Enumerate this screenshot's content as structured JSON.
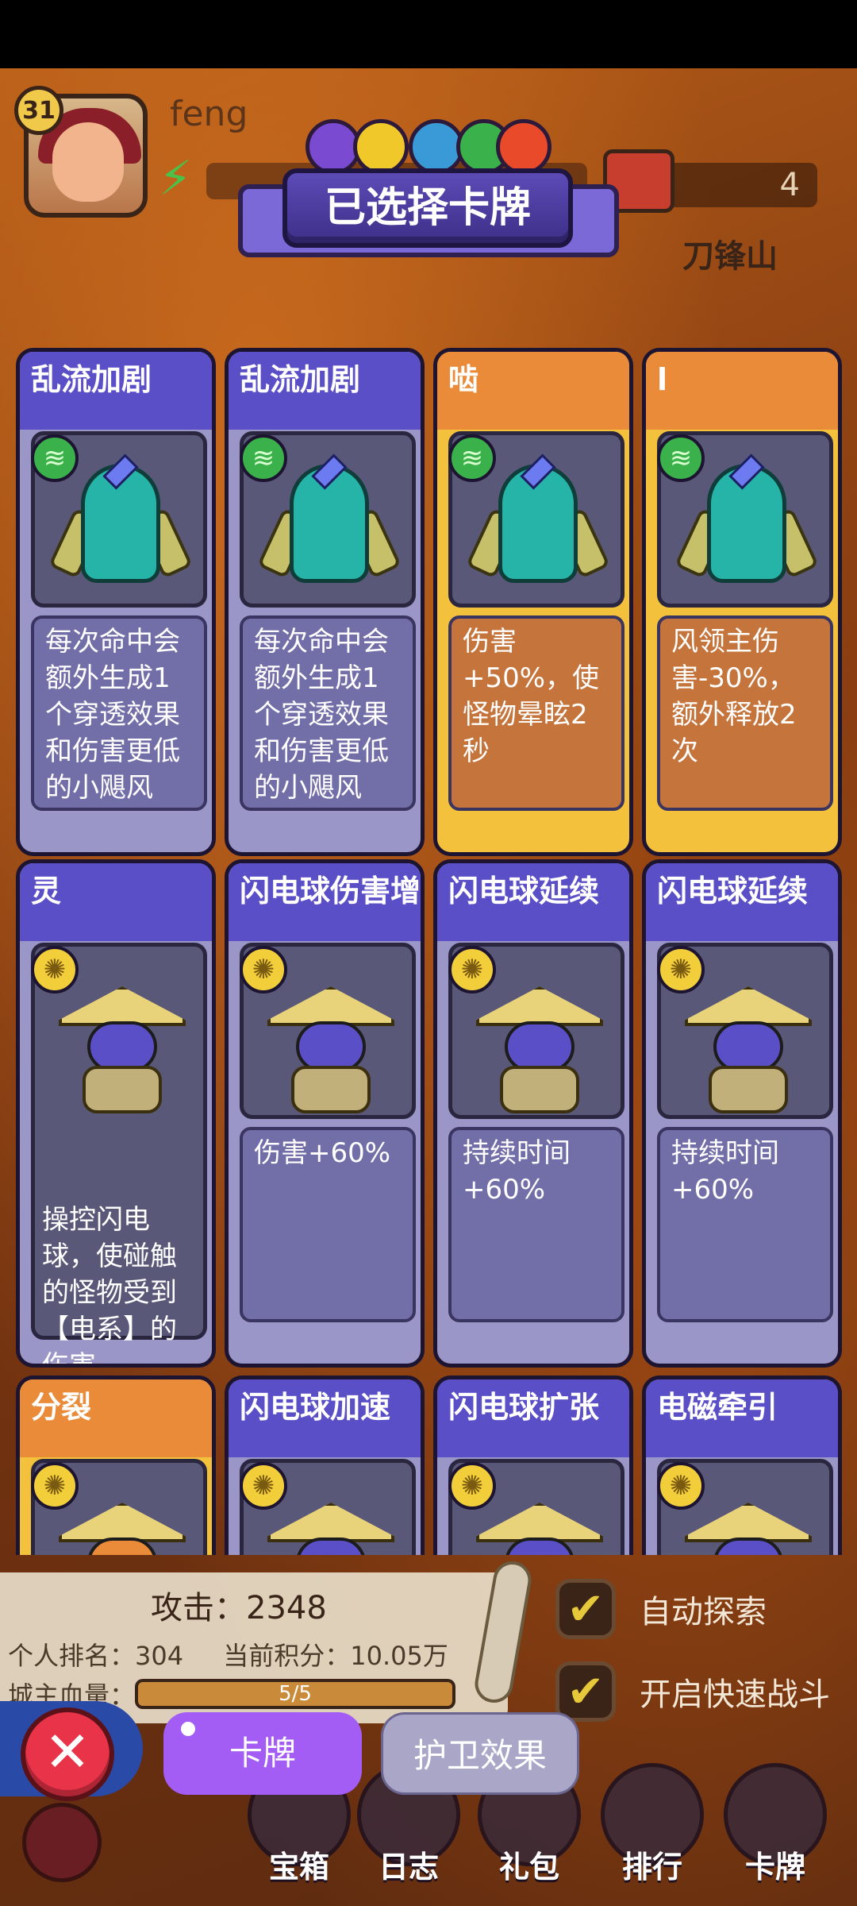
{
  "hud": {
    "level": "31",
    "username": "feng",
    "resource_value": "4",
    "location": "刀锋山"
  },
  "banner": {
    "title": "已选择卡牌"
  },
  "cards": [
    {
      "title": "乱流加剧",
      "color": "purple",
      "type": "wind",
      "desc": "每次命中会额外生成1个穿透效果和伤害更低的小飓风"
    },
    {
      "title": "乱流加剧",
      "color": "purple",
      "type": "wind",
      "desc": "每次命中会额外生成1个穿透效果和伤害更低的小飓风"
    },
    {
      "title": "啮",
      "color": "orange",
      "type": "wind",
      "desc": "伤害+50%，使怪物晕眩2秒"
    },
    {
      "title": "l",
      "color": "orange",
      "type": "wind",
      "desc": "风领主伤害-30%，额外释放2次"
    },
    {
      "title": "灵",
      "color": "purple",
      "type": "elec",
      "desc": "操控闪电球，使碰触的怪物受到【电系】的伤害"
    },
    {
      "title": "闪电球伤害增",
      "color": "purple",
      "type": "elec",
      "desc": "伤害+60%"
    },
    {
      "title": "闪电球延续",
      "color": "purple",
      "type": "elec",
      "desc": "持续时间+60%"
    },
    {
      "title": "闪电球延续",
      "color": "purple",
      "type": "elec",
      "desc": "持续时间+60%"
    },
    {
      "title": "分裂",
      "color": "orange",
      "type": "elec",
      "desc": ""
    },
    {
      "title": "闪电球加速",
      "color": "purple",
      "type": "elec",
      "desc": ""
    },
    {
      "title": "闪电球扩张",
      "color": "purple",
      "type": "elec",
      "desc": ""
    },
    {
      "title": "电磁牵引",
      "color": "purple",
      "type": "elec",
      "desc": ""
    }
  ],
  "stats": {
    "attack": "攻击：2348",
    "rank": "个人排名：304",
    "score": "当前积分：10.05万",
    "hp_label": "城主血量：",
    "hp_value": "5/5"
  },
  "toggles": {
    "auto_explore": "自动探索",
    "fast_battle": "开启快速战斗"
  },
  "tabs": {
    "cards": "卡牌",
    "guard": "护卫效果"
  },
  "nav": [
    "宝箱",
    "日志",
    "礼包",
    "排行",
    "卡牌"
  ]
}
